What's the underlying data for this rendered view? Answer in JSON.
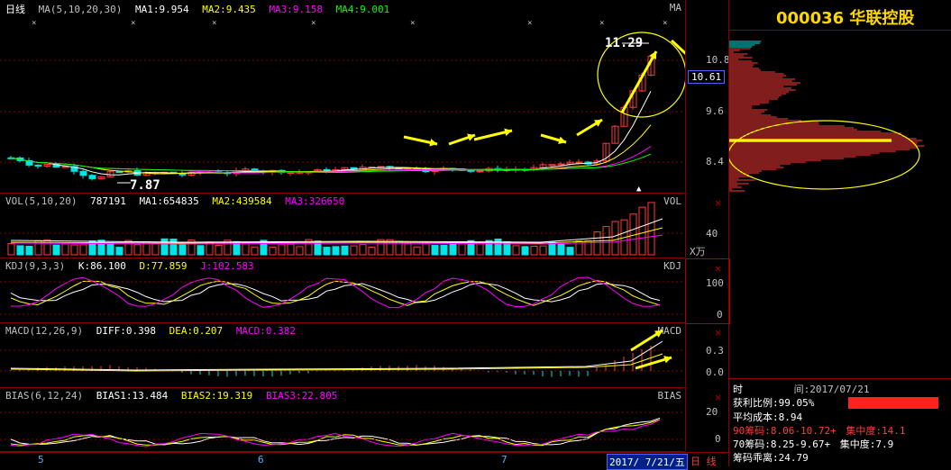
{
  "stock": {
    "code_name": "000036 华联控股"
  },
  "main_panel": {
    "period_label": "日线",
    "ma_params": "MA(5,10,20,30)",
    "ma1": "MA1:9.954",
    "ma2": "MA2:9.435",
    "ma3": "MA3:9.158",
    "ma4": "MA4:9.001",
    "right_label": "MA",
    "high_price": "11.29",
    "low_price": "7.87",
    "current_price": "10.61",
    "price_ticks": [
      "10.8",
      "9.6",
      "8.4"
    ]
  },
  "vol_panel": {
    "header": "VOL(5,10,20)",
    "value": "787191",
    "ma1": "MA1:654835",
    "ma2": "MA2:439584",
    "ma3": "MA3:326650",
    "right_label": "VOL",
    "ticks": [
      "40"
    ],
    "unit": "X万"
  },
  "kdj_panel": {
    "header": "KDJ(9,3,3)",
    "k": "K:86.100",
    "d": "D:77.859",
    "j": "J:102.583",
    "right_label": "KDJ",
    "ticks": [
      "100",
      "0"
    ]
  },
  "macd_panel": {
    "header": "MACD(12,26,9)",
    "diff": "DIFF:0.398",
    "dea": "DEA:0.207",
    "macd": "MACD:0.382",
    "right_label": "MACD",
    "ticks": [
      "0.3",
      "0.0"
    ]
  },
  "bias_panel": {
    "header": "BIAS(6,12,24)",
    "bias1": "BIAS1:13.484",
    "bias2": "BIAS2:19.319",
    "bias3": "BIAS3:22.805",
    "right_label": "BIAS",
    "ticks": [
      "20",
      "0"
    ]
  },
  "x_axis": {
    "months": [
      "5",
      "6",
      "7"
    ],
    "date_box": "2017/ 7/21/五",
    "period_tab": "日 线"
  },
  "chip_info": {
    "time_label": "时",
    "time_value": "间:2017/07/21",
    "profit_ratio": "获利比例:99.05%",
    "avg_cost": "平均成本:8.94",
    "chip90": "90筹码:8.06-10.72+",
    "chip90_conc": "集中度:14.1",
    "chip70": "70筹码:8.25-9.67+",
    "chip70_conc": "集中度:7.9",
    "divergence": "筹码乖离:24.79"
  },
  "colors": {
    "up": "#ff3c3c",
    "down": "#00e5e5",
    "ma1": "#ffffff",
    "ma2": "#ffff00",
    "ma3": "#ff00ff",
    "ma4": "#00ff00",
    "arrow": "#ffff00",
    "grid": "#8a0000"
  }
}
